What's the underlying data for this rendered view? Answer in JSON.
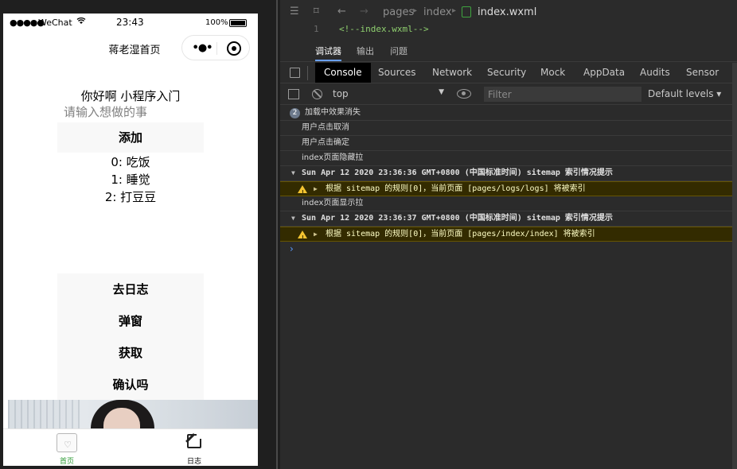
{
  "statusbar": {
    "signal": "●●●●●",
    "carrier": "WeChat",
    "time": "23:43",
    "battery": "100%"
  },
  "navbar": {
    "title": "蒋老湿首页",
    "capsule_more": "•●•"
  },
  "page": {
    "greeting": "你好啊 小程序入门",
    "input_placeholder": "请输入想做的事",
    "add_button": "添加",
    "todos": [
      "0: 吃饭",
      "1: 睡觉",
      "2: 打豆豆"
    ],
    "buttons": [
      "去日志",
      "弹窗",
      "获取",
      "确认吗"
    ]
  },
  "tabbar": [
    {
      "label": "首页",
      "icon": "home-icon",
      "active": true
    },
    {
      "label": "日志",
      "icon": "edit-icon",
      "active": false
    }
  ],
  "editor": {
    "breadcrumb": [
      "pages",
      "index"
    ],
    "file": "index.wxml",
    "line_number": "1",
    "code": "<!--index.wxml-->"
  },
  "panel_tabs": [
    "调试器",
    "输出",
    "问题"
  ],
  "devtools_tabs": [
    "Console",
    "Sources",
    "Network",
    "Security",
    "Mock",
    "AppData",
    "Audits",
    "Sensor"
  ],
  "console_toolbar": {
    "context": "top",
    "filter_placeholder": "Filter",
    "levels": "Default levels ▾"
  },
  "console": {
    "repeat_badge": "2",
    "lines": [
      "加载中效果消失",
      "用户点击取消",
      "用户点击确定",
      "index页面隐藏拉",
      "Sun Apr 12 2020 23:36:36 GMT+0800 (中国标准时间) sitemap 索引情况提示",
      "根据 sitemap 的规则[0]，当前页面 [pages/logs/logs] 将被索引",
      "index页面显示拉",
      "Sun Apr 12 2020 23:36:37 GMT+0800 (中国标准时间) sitemap 索引情况提示",
      "根据 sitemap 的规则[0]，当前页面 [pages/index/index] 将被索引"
    ],
    "prompt": "›"
  }
}
